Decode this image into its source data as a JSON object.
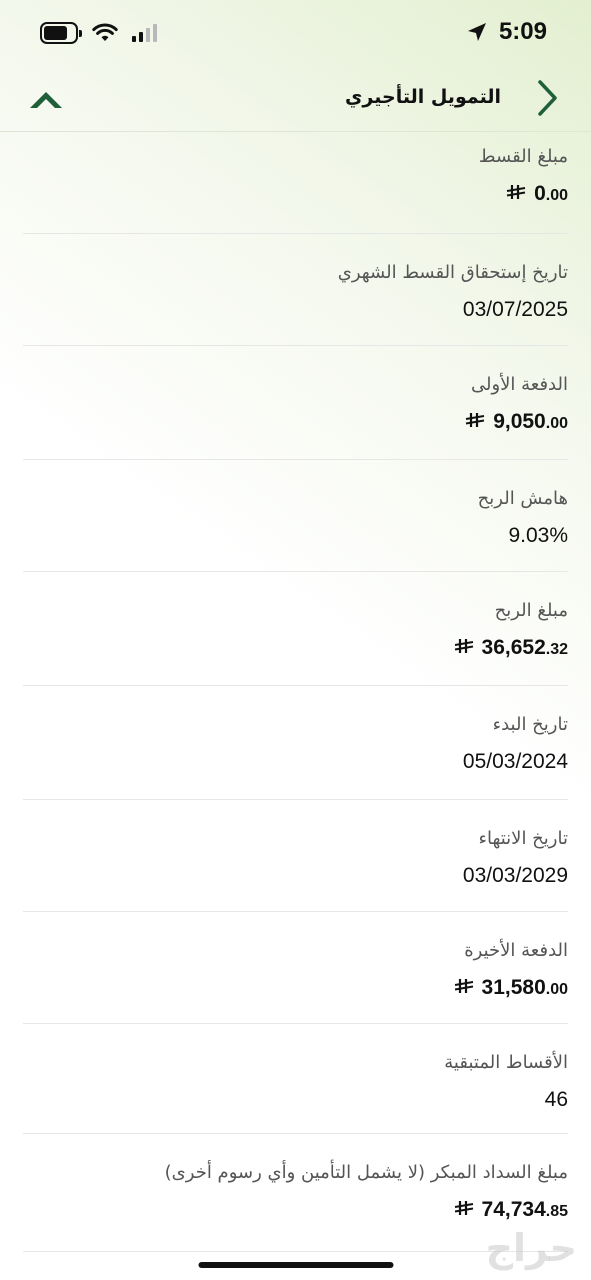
{
  "status_bar": {
    "time": "5:09",
    "battery_level": 0.75,
    "signal_bars_active": 2,
    "icons": [
      "battery-icon",
      "wifi-icon",
      "signal-icon",
      "location-arrow-icon"
    ]
  },
  "nav": {
    "title": "التمويل التأجيري",
    "back_icon": "chevron-right-icon",
    "collapse_icon": "chevron-up-icon",
    "accent_color": "#1f5f3a"
  },
  "rows": [
    {
      "label": "مبلغ القسط",
      "currency": true,
      "int": "0",
      "dec": ".00"
    },
    {
      "label": "تاريخ إستحقاق القسط الشهري",
      "currency": false,
      "text": "03/07/2025"
    },
    {
      "label": "الدفعة الأولى",
      "currency": true,
      "int": "9,050",
      "dec": ".00"
    },
    {
      "label": "هامش الربح",
      "currency": false,
      "text": "9.03%"
    },
    {
      "label": "مبلغ الربح",
      "currency": true,
      "int": "36,652",
      "dec": ".32"
    },
    {
      "label": "تاريخ البدء",
      "currency": false,
      "text": "05/03/2024"
    },
    {
      "label": "تاريخ الانتهاء",
      "currency": false,
      "text": "03/03/2029"
    },
    {
      "label": "الدفعة الأخيرة",
      "currency": true,
      "int": "31,580",
      "dec": ".00"
    },
    {
      "label": "الأقساط المتبقية",
      "currency": false,
      "text": "46"
    },
    {
      "label": "مبلغ السداد المبكر (لا يشمل التأمين وأي رسوم أخرى)",
      "currency": true,
      "int": "74,734",
      "dec": ".85"
    }
  ],
  "watermark": "حراج"
}
